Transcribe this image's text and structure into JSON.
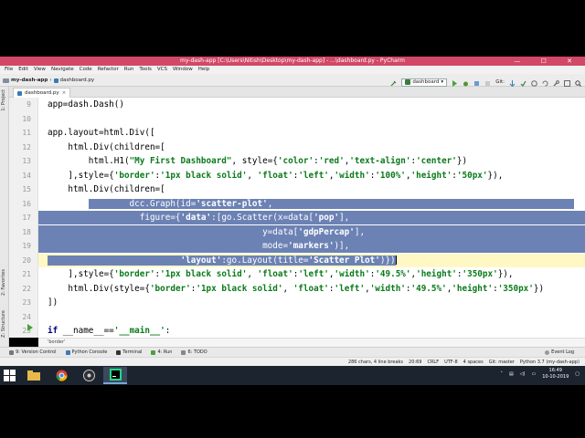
{
  "window": {
    "title": "my-dash-app [C:\\Users\\Nitish\\Desktop\\my-dash-app] - ...\\dashboard.py - PyCharm",
    "controls": "— ☐ ✕"
  },
  "menu": [
    "File",
    "Edit",
    "View",
    "Navigate",
    "Code",
    "Refactor",
    "Run",
    "Tools",
    "VCS",
    "Window",
    "Help"
  ],
  "nav": {
    "project": "my-dash-app",
    "file": "dashboard.py",
    "run_config": "dashboard",
    "git_label": "Git:"
  },
  "tab": {
    "label": "dashboard.py",
    "close": "×"
  },
  "side_labels": {
    "project": "1: Project",
    "favorites": "2: Favorites",
    "structure": "Z: Structure"
  },
  "code": {
    "lines": [
      {
        "num": "9"
      },
      {
        "num": "10"
      },
      {
        "num": "11"
      },
      {
        "num": "12"
      },
      {
        "num": "13"
      },
      {
        "num": "14"
      },
      {
        "num": "15"
      },
      {
        "num": "16"
      },
      {
        "num": "17"
      },
      {
        "num": "18"
      },
      {
        "num": "19"
      },
      {
        "num": "20"
      },
      {
        "num": "21"
      },
      {
        "num": "22"
      },
      {
        "num": "23"
      },
      {
        "num": "24"
      },
      {
        "num": "25"
      }
    ],
    "l9": "app=dash.Dash()",
    "l11": "app.layout=html.Div([",
    "l12a": "    html.Div(children=[",
    "l13a": "        html.H1(",
    "l13s1": "\"My First Dashboard\"",
    "l13b": ", style={",
    "l13s2": "'color'",
    "l13c": ":",
    "l13s3": "'red'",
    "l13d": ",",
    "l13s4": "'text-align'",
    "l13e": ":",
    "l13s5": "'center'",
    "l13f": "})",
    "l14a": "    ],style={",
    "l14s1": "'border'",
    "l14b": ":",
    "l14s2": "'1px black solid'",
    "l14c": ", ",
    "l14s3": "'float'",
    "l14d": ":",
    "l14s4": "'left'",
    "l14e": ",",
    "l14s5": "'width'",
    "l14f": ":",
    "l14s6": "'100%'",
    "l14g": ",",
    "l14s7": "'height'",
    "l14h": ":",
    "l14s8": "'50px'",
    "l14i": "}),",
    "l15a": "    html.Div(children=[",
    "l16a": "        dcc.Graph(id=",
    "l16s1": "'scatter-plot'",
    "l16b": ",",
    "l17a": "                  figure={",
    "l17s1": "'data'",
    "l17b": ":[go.Scatter(x=data[",
    "l17s2": "'pop'",
    "l17c": "],",
    "l18a": "                                          y=data[",
    "l18s1": "'gdpPercap'",
    "l18b": "],",
    "l19a": "                                          mode=",
    "l19s1": "'markers'",
    "l19b": ")],",
    "l20a": "                          ",
    "l20s1": "'layout'",
    "l20b": ":go.Layout(title=",
    "l20s2": "'Scatter Plot'",
    "l20c": ")})",
    "l21a": "    ],style={",
    "l21s1": "'border'",
    "l21b": ":",
    "l21s2": "'1px black solid'",
    "l21c": ", ",
    "l21s3": "'float'",
    "l21d": ":",
    "l21s4": "'left'",
    "l21e": ",",
    "l21s5": "'width'",
    "l21f": ":",
    "l21s6": "'49.5%'",
    "l21g": ",",
    "l21s7": "'height'",
    "l21h": ":",
    "l21s8": "'350px'",
    "l21i": "}),",
    "l22a": "    html.Div(style={",
    "l22s1": "'border'",
    "l22b": ":",
    "l22s2": "'1px black solid'",
    "l22c": ", ",
    "l22s3": "'float'",
    "l22d": ":",
    "l22s4": "'left'",
    "l22e": ",",
    "l22s5": "'width'",
    "l22f": ":",
    "l22s6": "'49.5%'",
    "l22g": ",",
    "l22s7": "'height'",
    "l22h": ":",
    "l22s8": "'350px'",
    "l22i": "})",
    "l23": "])",
    "l25kw": "if",
    "l25a": " __name__==",
    "l25s1": "'__main__'",
    "l25b": ":"
  },
  "breadcrumb": "'border'",
  "bottom_tools": {
    "version_control": "9: Version Control",
    "python_console": "Python Console",
    "terminal": "Terminal",
    "run": "4: Run",
    "todo": "6: TODO",
    "event_log": "Event Log"
  },
  "status": {
    "chars": "286 chars, 4 line breaks",
    "position": "20:69",
    "line_sep": "CRLF",
    "encoding": "UTF-8",
    "indent": "4 spaces",
    "git": "Git: master",
    "interpreter": "Python 3.7 (my-dash-app)"
  },
  "taskbar": {
    "time": "16:49",
    "date": "10-10-2019"
  },
  "colors": {
    "titlebar": "#d24866",
    "selection": "#6c82b4",
    "string": "#0a7a1a",
    "current_line": "#fff8c4"
  }
}
